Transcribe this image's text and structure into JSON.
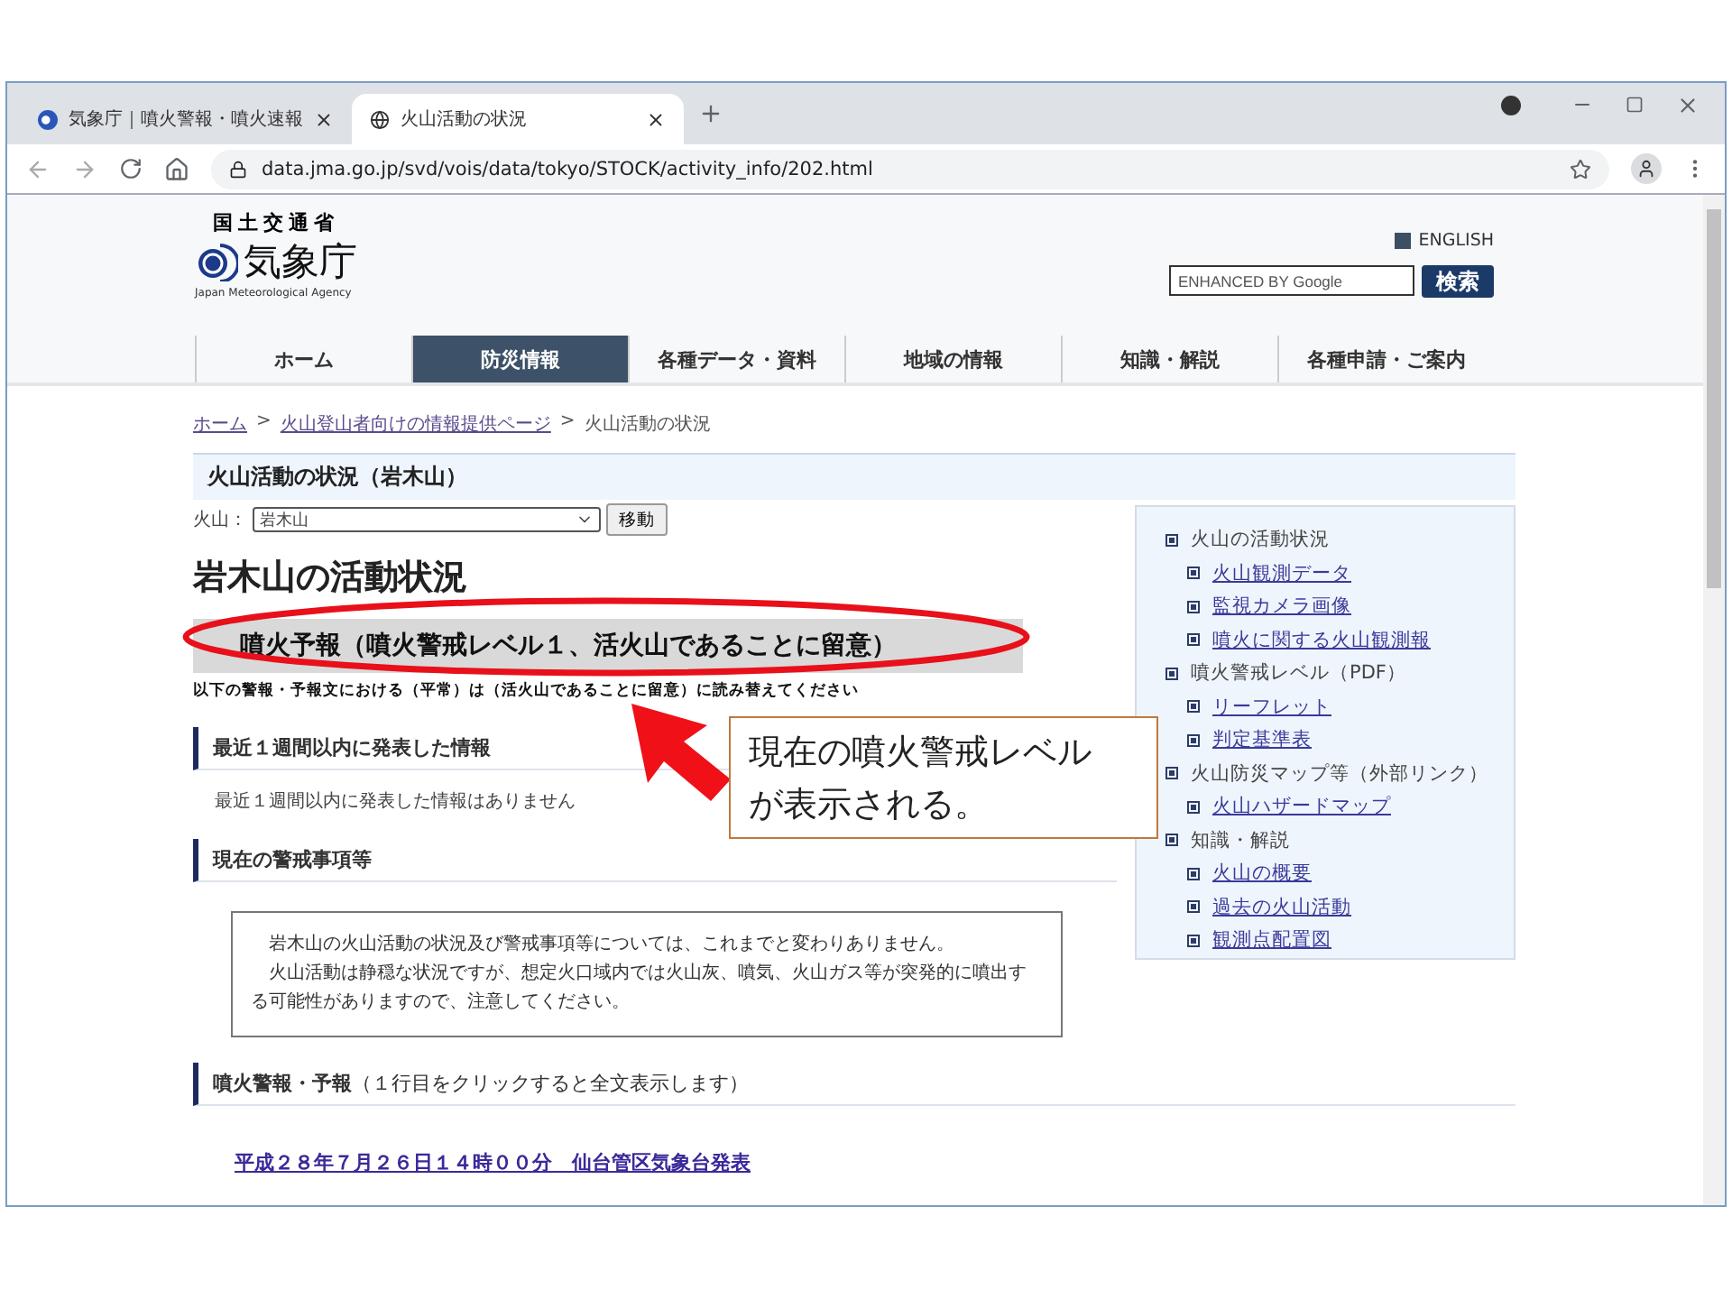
{
  "browser": {
    "tabs": [
      {
        "title": "気象庁｜噴火警報・噴火速報",
        "selected": false
      },
      {
        "title": "火山活動の状況",
        "selected": true
      }
    ],
    "url": "data.jma.go.jp/svd/vois/data/tokyo/STOCK/activity_info/202.html"
  },
  "site_header": {
    "ministry": "国土交通省",
    "agency": "気象庁",
    "agency_en": "Japan Meteorological Agency",
    "english_link": "ENGLISH",
    "search": {
      "placeholder": "ENHANCED BY Google"
    },
    "search_button": "検索"
  },
  "nav": [
    {
      "label": "ホーム",
      "selected": false
    },
    {
      "label": "防災情報",
      "selected": true
    },
    {
      "label": "各種データ・資料",
      "selected": false
    },
    {
      "label": "地域の情報",
      "selected": false
    },
    {
      "label": "知識・解説",
      "selected": false
    },
    {
      "label": "各種申請・ご案内",
      "selected": false
    }
  ],
  "breadcrumb": [
    {
      "label": "ホーム",
      "kind": "link"
    },
    {
      "label": ">",
      "kind": "separator"
    },
    {
      "label": "火山登山者向けの情報提供ページ",
      "kind": "link"
    },
    {
      "label": ">",
      "kind": "separator"
    },
    {
      "label": "火山活動の状況",
      "kind": "current"
    }
  ],
  "page_title": "火山活動の状況（岩木山）",
  "volcano_select": {
    "label": "火山：",
    "value": "岩木山",
    "button": "移動"
  },
  "heading": "岩木山の活動状況",
  "alert_level": "噴火予報（噴火警戒レベル１、活火山であることに留意）",
  "alert_note": "以下の警報・予報文における（平常）は（活火山であることに留意）に読み替えてください",
  "sections": [
    {
      "kind": "text",
      "title": "最近１週間以内に発表した情報",
      "text": "最近１週間以内に発表した情報はありません"
    },
    {
      "kind": "box",
      "title": "現在の警戒事項等",
      "paragraphs": [
        "岩木山の火山活動の状況及び警戒事項等については、これまでと変わりありません。",
        "火山活動は静穏な状況ですが、想定火口域内では火山灰、噴気、火山ガス等が突発的に噴出する可能性がありますので、注意してください。"
      ]
    },
    {
      "kind": "link",
      "title": "**噴火警報・予報**（１行目をクリックすると全文表示します）",
      "link": "平成２８年７月２６日１４時００分　仙台管区気象台発表"
    }
  ],
  "sidebar": [
    {
      "label": "火山の活動状況",
      "children": [
        {
          "label": "火山観測データ",
          "kind": "link"
        },
        {
          "label": "監視カメラ画像",
          "kind": "link"
        },
        {
          "label": "噴火に関する火山観測報",
          "kind": "link"
        }
      ]
    },
    {
      "label": "噴火警戒レベル（PDF）",
      "children": [
        {
          "label": "リーフレット",
          "kind": "link"
        },
        {
          "label": "判定基準表",
          "kind": "link"
        }
      ]
    },
    {
      "label": "火山防災マップ等（外部リンク）",
      "children": [
        {
          "label": "火山ハザードマップ",
          "kind": "link"
        }
      ]
    },
    {
      "label": "知識・解説",
      "children": [
        {
          "label": "火山の概要",
          "kind": "link"
        },
        {
          "label": "過去の火山活動",
          "kind": "link"
        },
        {
          "label": "観測点配置図",
          "kind": "link"
        }
      ]
    }
  ],
  "annotation": {
    "lines": [
      "現在の噴火警戒レベル",
      "が表示される。"
    ]
  }
}
